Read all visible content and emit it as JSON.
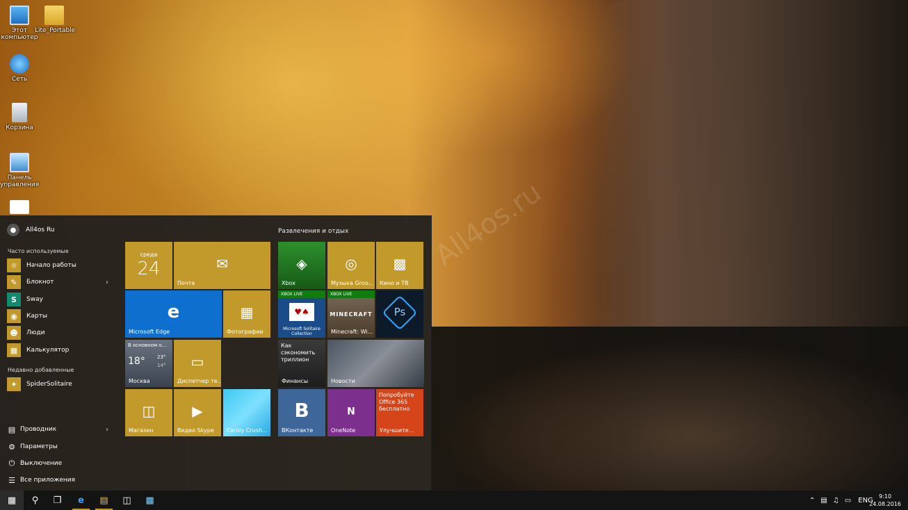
{
  "desktop": {
    "icons": [
      {
        "label": "Этот компьютер",
        "icon": "computer-icon"
      },
      {
        "label": "Lite_Portable",
        "icon": "folder-icon"
      },
      {
        "label": "Сеть",
        "icon": "network-icon"
      },
      {
        "label": "Корзина",
        "icon": "recycle-bin-icon"
      },
      {
        "label": "Панель управления",
        "icon": "control-panel-icon"
      }
    ],
    "watermark": "All4os.ru"
  },
  "start_menu": {
    "user": "All4os Ru",
    "most_used_label": "Часто используемые",
    "most_used": [
      {
        "label": "Начало работы",
        "icon": "lightbulb-icon",
        "color": "#c29a2b"
      },
      {
        "label": "Блокнот",
        "icon": "notepad-icon",
        "color": "#c29a2b",
        "has_submenu": true
      },
      {
        "label": "Sway",
        "icon": "sway-icon",
        "color": "#138a6c"
      },
      {
        "label": "Карты",
        "icon": "maps-icon",
        "color": "#c29a2b"
      },
      {
        "label": "Люди",
        "icon": "people-icon",
        "color": "#c29a2b"
      },
      {
        "label": "Калькулятор",
        "icon": "calculator-icon",
        "color": "#c29a2b"
      }
    ],
    "recent_label": "Недавно добавленные",
    "recent": [
      {
        "label": "SpiderSolitaire",
        "icon": "spider-icon",
        "color": "#c29a2b"
      }
    ],
    "system": [
      {
        "label": "Проводник",
        "icon": "explorer-icon",
        "has_submenu": true
      },
      {
        "label": "Параметры",
        "icon": "gear-icon"
      },
      {
        "label": "Выключение",
        "icon": "power-icon"
      },
      {
        "label": "Все приложения",
        "icon": "all-apps-icon"
      }
    ],
    "group_title": "Развлечения и отдых",
    "tiles": {
      "calendar": {
        "day": "среда",
        "date": "24"
      },
      "mail": "Почта",
      "edge": "Microsoft Edge",
      "photos": "Фотографии",
      "weather": {
        "headline": "В основном о...",
        "temp": "18°",
        "high": "23°",
        "low": "14°",
        "city": "Москва"
      },
      "task_manager": "Диспетчер те...",
      "store": "Магазин",
      "skype": "Видео Skype",
      "candy": "Candy Crush...",
      "xbox": "Xbox",
      "groove": "Музыка Groo...",
      "movies": "Кино и ТВ",
      "solitaire": {
        "badge": "XBOX LIVE",
        "label": "Microsoft Solitaire Collection"
      },
      "minecraft": {
        "badge": "XBOX LIVE",
        "label": "Minecraft: Wi..."
      },
      "finance": {
        "headline": "Как сэкономить триллион",
        "label": "Финансы"
      },
      "news": "Новости",
      "vk": "ВКонтакте",
      "onenote": "OneNote",
      "office": {
        "headline": "Попробуйте Office 365 бесплатно",
        "label": "Улучшите..."
      }
    }
  },
  "taskbar": {
    "tray_lang": "ENG",
    "time": "9:10",
    "date": "24.08.2016"
  }
}
